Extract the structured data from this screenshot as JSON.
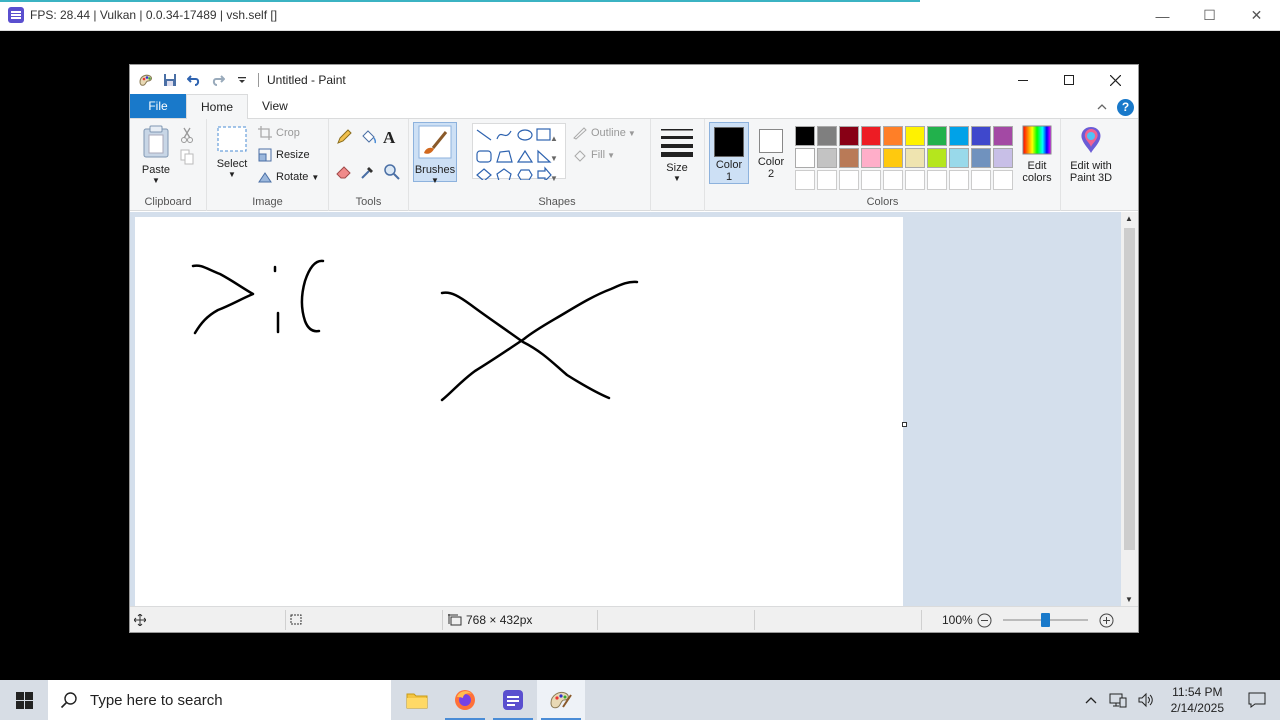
{
  "host_window": {
    "title": "FPS: 28.44 | Vulkan | 0.0.34-17489 | vsh.self []",
    "minimize": "—",
    "maximize": "☐",
    "close": "✕"
  },
  "paint": {
    "title": "Untitled - Paint",
    "tabs": {
      "file": "File",
      "home": "Home",
      "view": "View"
    },
    "help": "?",
    "clipboard": {
      "paste": "Paste",
      "group": "Clipboard"
    },
    "image": {
      "select": "Select",
      "crop": "Crop",
      "resize": "Resize",
      "rotate": "Rotate",
      "group": "Image"
    },
    "tools": {
      "group": "Tools",
      "text_tool": "A"
    },
    "brushes": {
      "label": "Brushes"
    },
    "shapes": {
      "outline": "Outline",
      "fill": "Fill",
      "group": "Shapes"
    },
    "size": {
      "label": "Size"
    },
    "colors": {
      "color1": "Color\n1",
      "color1_a": "Color",
      "color1_b": "1",
      "color2_a": "Color",
      "color2_b": "2",
      "edit_colors_a": "Edit",
      "edit_colors_b": "colors",
      "edit3d_a": "Edit with",
      "edit3d_b": "Paint 3D",
      "group": "Colors",
      "color1_value": "#000000",
      "color2_value": "#ffffff",
      "palette_row1": [
        "#000000",
        "#7f7f7f",
        "#880015",
        "#ed1c24",
        "#ff7f27",
        "#fff200",
        "#22b14c",
        "#00a2e8",
        "#3f48cc",
        "#a349a4"
      ],
      "palette_row2": [
        "#ffffff",
        "#c3c3c3",
        "#b97a57",
        "#ffaec9",
        "#ffc90e",
        "#efe4b0",
        "#b5e61d",
        "#99d9ea",
        "#7092be",
        "#c8bfe7"
      ],
      "palette_row3": [
        "#ffffff",
        "#ffffff",
        "#ffffff",
        "#ffffff",
        "#ffffff",
        "#ffffff",
        "#ffffff",
        "#ffffff",
        "#ffffff",
        "#ffffff"
      ]
    },
    "status": {
      "dimensions": "768 × 432px",
      "zoom": "100%"
    }
  },
  "taskbar": {
    "search_placeholder": "Type here to search",
    "time": "11:54 PM",
    "date": "2/14/2025"
  }
}
